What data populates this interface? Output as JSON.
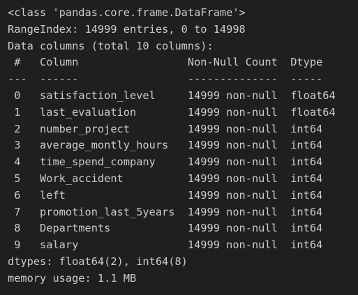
{
  "output": {
    "class_line": "<class 'pandas.core.frame.DataFrame'>",
    "range_index": "RangeIndex: 14999 entries, 0 to 14998",
    "data_columns": "Data columns (total 10 columns):",
    "header": " #   Column                 Non-Null Count  Dtype  ",
    "separator": "---  ------                 --------------  -----  ",
    "rows": [
      " 0   satisfaction_level     14999 non-null  float64",
      " 1   last_evaluation        14999 non-null  float64",
      " 2   number_project         14999 non-null  int64  ",
      " 3   average_montly_hours   14999 non-null  int64  ",
      " 4   time_spend_company     14999 non-null  int64  ",
      " 5   Work_accident          14999 non-null  int64  ",
      " 6   left                   14999 non-null  int64  ",
      " 7   promotion_last_5years  14999 non-null  int64  ",
      " 8   Departments            14999 non-null  int64  ",
      " 9   salary                 14999 non-null  int64  "
    ],
    "dtypes": "dtypes: float64(2), int64(8)",
    "memory": "memory usage: 1.1 MB"
  }
}
